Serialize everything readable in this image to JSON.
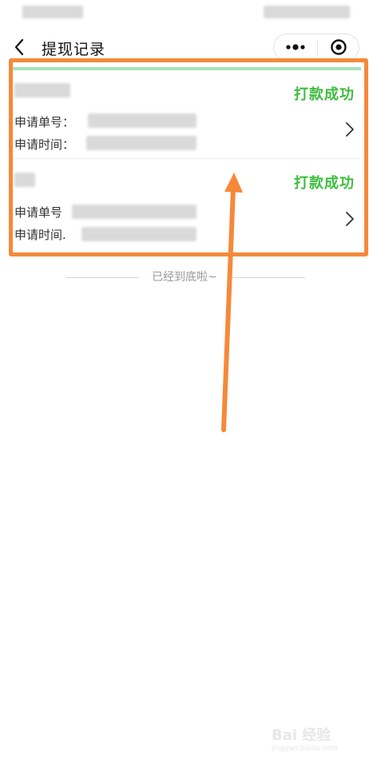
{
  "nav": {
    "title": "提现记录"
  },
  "records": [
    {
      "status": "打款成功",
      "order_label": "申请单号：",
      "time_label": "申请时间："
    },
    {
      "status": "打款成功",
      "order_label": "申请单号",
      "time_label": "申请时间."
    }
  ],
  "footer": {
    "end_tip": "已经到底啦~"
  },
  "watermark": {
    "logo": "Bai 经验",
    "sub": "jingyan.baidu.com"
  },
  "icons": {
    "back": "chevron-left-icon",
    "more": "more-dots-icon",
    "close": "target-close-icon",
    "detail": "chevron-right-icon"
  },
  "colors": {
    "success_green": "#3fbd3f",
    "annotation_orange": "#f5893a",
    "progress_green": "#a6e3b8"
  }
}
